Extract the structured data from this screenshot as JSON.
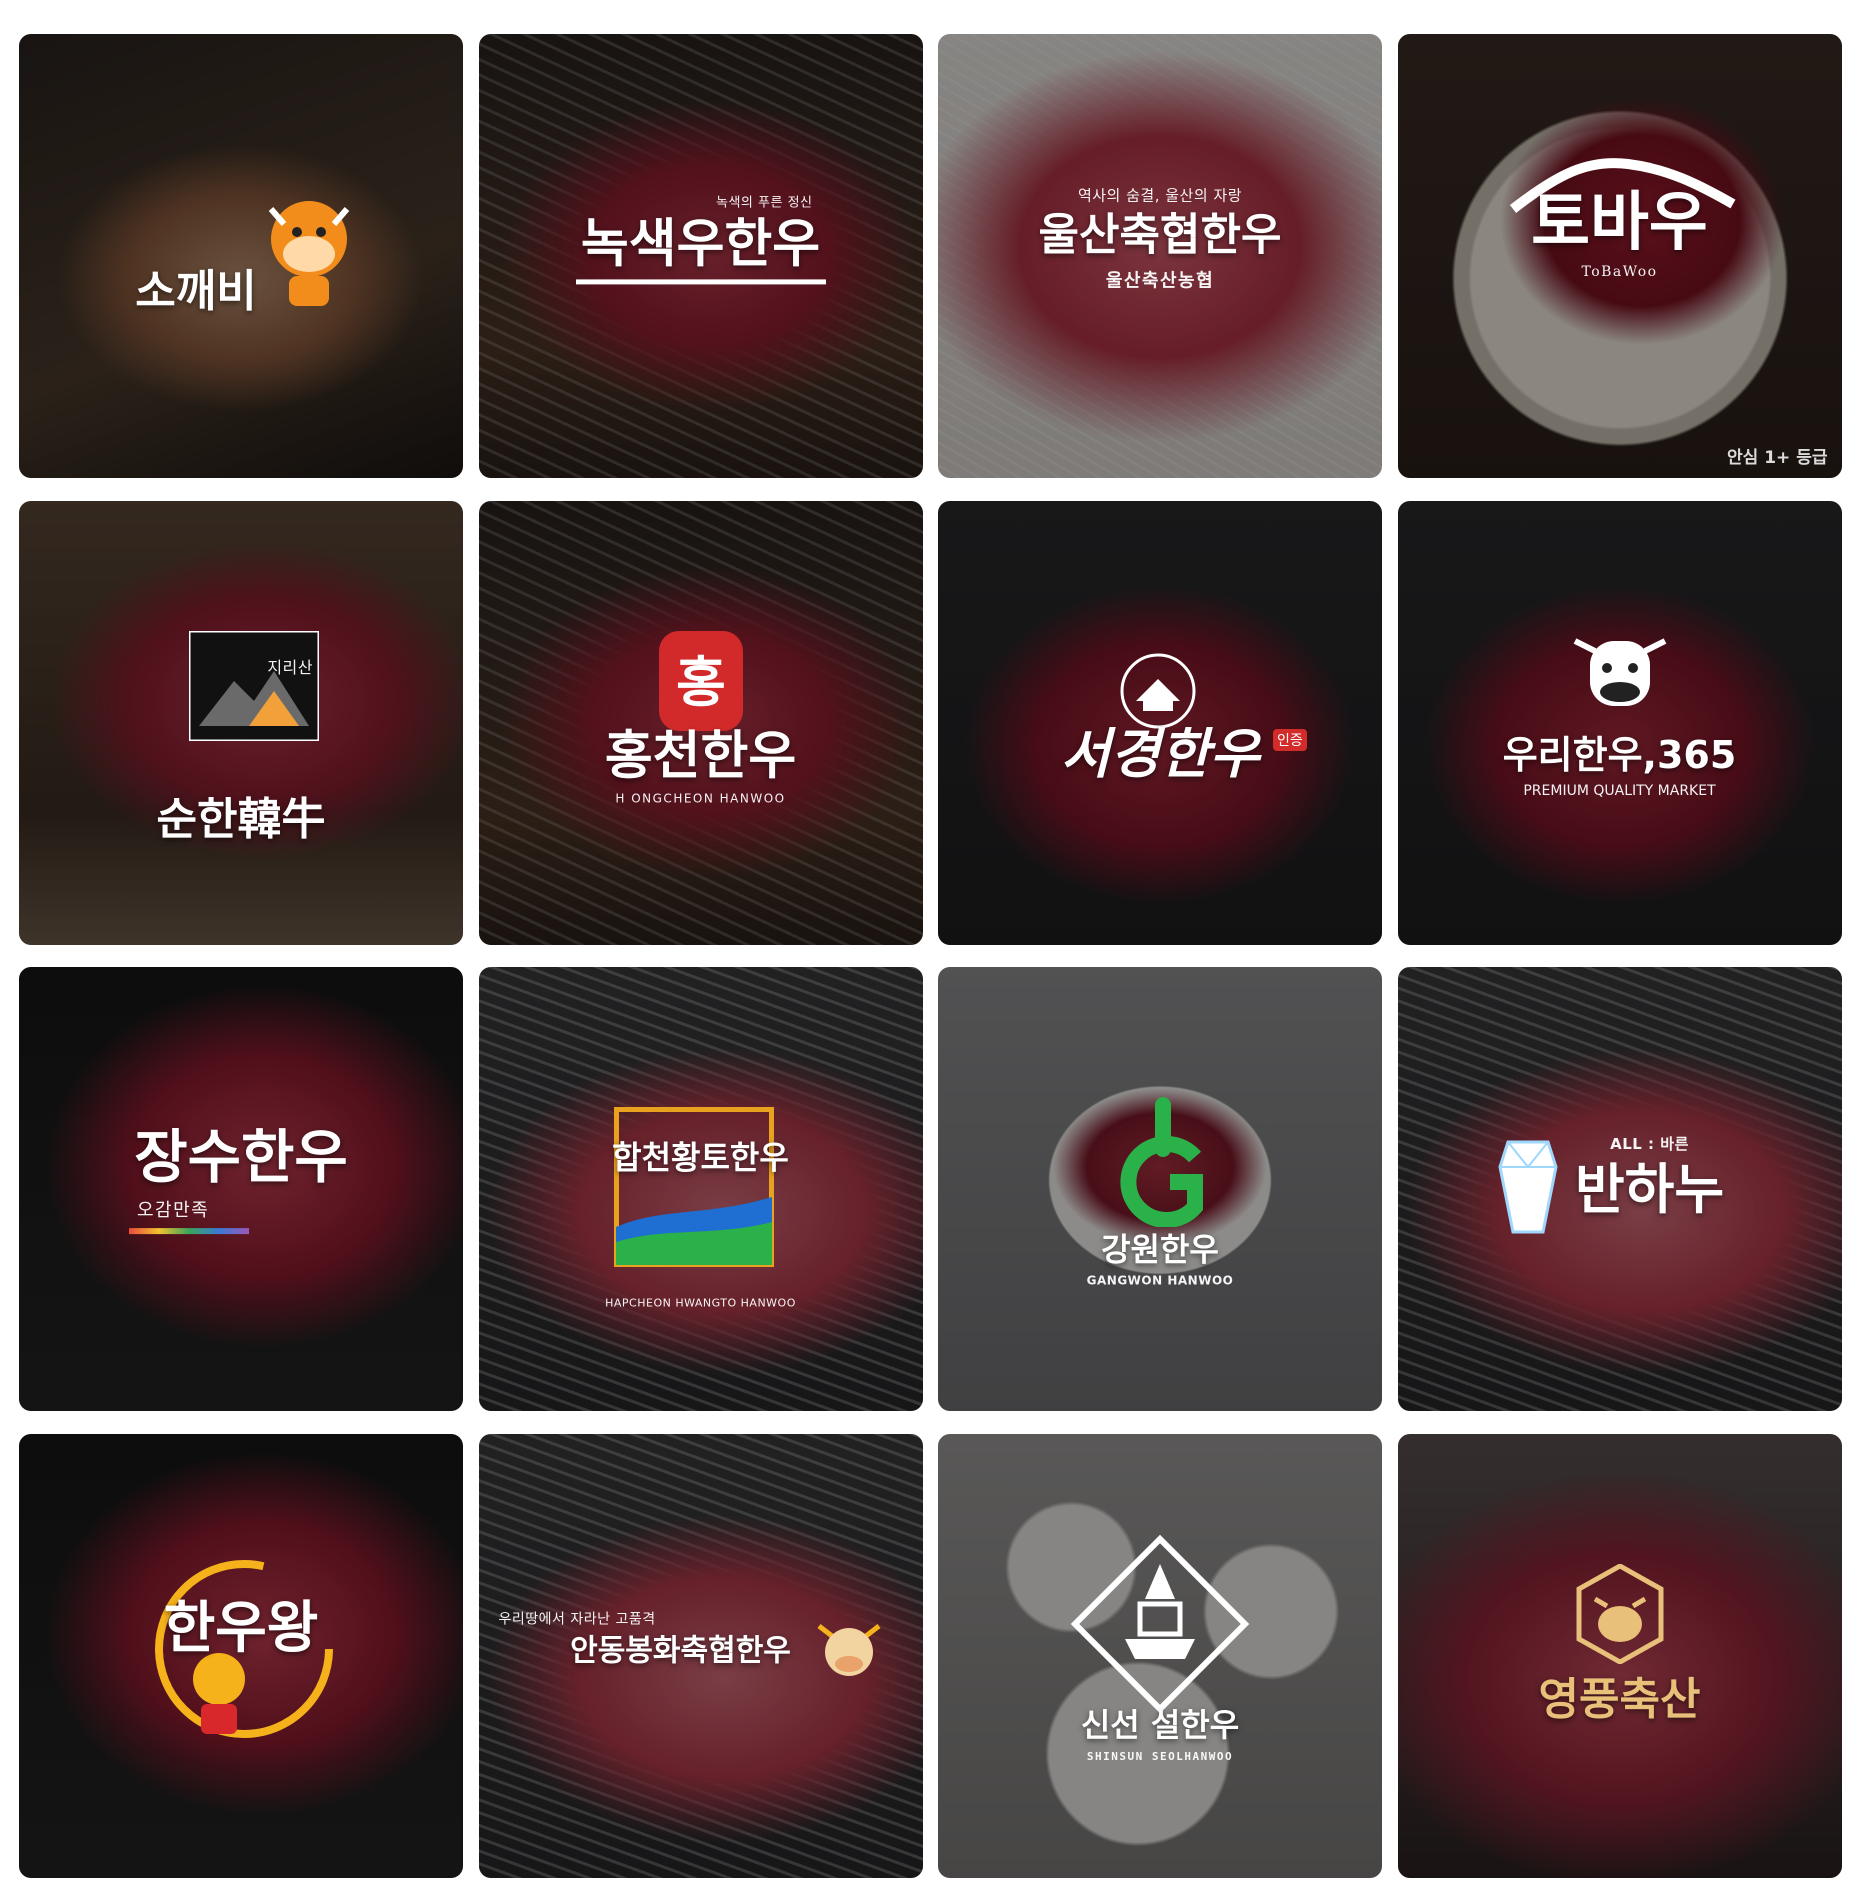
{
  "brands": [
    {
      "name": "소깨비",
      "tag": "",
      "sub": "",
      "corner": "",
      "accent": "#f28c1b",
      "emblem": "cow-mascot-icon"
    },
    {
      "name": "녹색우한우",
      "tag": "녹색의 푸른 정신",
      "sub": "",
      "corner": "",
      "accent": "#ffffff",
      "emblem": "ox-horns-icon"
    },
    {
      "name": "울산축협한우",
      "tag": "역사의 숨결, 울산의 자랑",
      "sub": "울산축산농협",
      "corner": "",
      "accent": "#ffffff",
      "emblem": "coop-icon"
    },
    {
      "name": "토바우",
      "tag": "",
      "sub": "ToBaWoo",
      "corner": "안심 1+ 등급",
      "accent": "#ffffff",
      "emblem": "mountain-brush-icon"
    },
    {
      "name": "순한韓牛",
      "tag": "지리산",
      "sub": "",
      "corner": "",
      "accent": "#ffffff",
      "emblem": "mountain-icon"
    },
    {
      "name": "홍천한우",
      "tag": "",
      "sub": "H ONGCHEON HANWOO",
      "corner": "",
      "accent": "#d22a2a",
      "emblem": "hong-seal-icon"
    },
    {
      "name": "서경한우",
      "tag": "",
      "sub": "",
      "corner": "",
      "accent": "#e23b4a",
      "emblem": "barn-badge-icon"
    },
    {
      "name": "우리한우,365",
      "tag": "",
      "sub": "PREMIUM QUALITY MARKET",
      "corner": "",
      "accent": "#ffffff",
      "emblem": "cow-face-icon"
    },
    {
      "name": "장수한우",
      "tag": "",
      "sub": "오감만족",
      "corner": "",
      "accent": "#ffffff",
      "emblem": "longevity-icon"
    },
    {
      "name": "합천황토한우",
      "tag": "",
      "sub": "HAPCHEON HWANGTO HANWOO",
      "corner": "",
      "accent": "#e8a21e",
      "emblem": "hwangto-icon"
    },
    {
      "name": "강원한우",
      "tag": "",
      "sub": "GANGWON HANWOO",
      "corner": "",
      "accent": "#2bb14a",
      "emblem": "gangwon-g-icon"
    },
    {
      "name": "반하누",
      "tag": "ALL : 바른",
      "sub": "",
      "corner": "",
      "accent": "#ffffff",
      "emblem": "crystal-icon"
    },
    {
      "name": "한우왕",
      "tag": "",
      "sub": "",
      "corner": "",
      "accent": "#f5b21a",
      "emblem": "king-cow-icon"
    },
    {
      "name": "안동봉화축협한우",
      "tag": "우리땅에서 자라난 고품격",
      "sub": "",
      "corner": "",
      "accent": "#f5b21a",
      "emblem": "cow-head-icon"
    },
    {
      "name": "신선 설한우",
      "tag": "",
      "sub": "SHINSUN SEOLHANWOO",
      "corner": "",
      "accent": "#ffffff",
      "emblem": "tower-diamond-icon"
    },
    {
      "name": "영풍축산",
      "tag": "",
      "sub": "",
      "corner": "",
      "accent": "#e8c079",
      "emblem": "gold-ox-icon"
    }
  ]
}
